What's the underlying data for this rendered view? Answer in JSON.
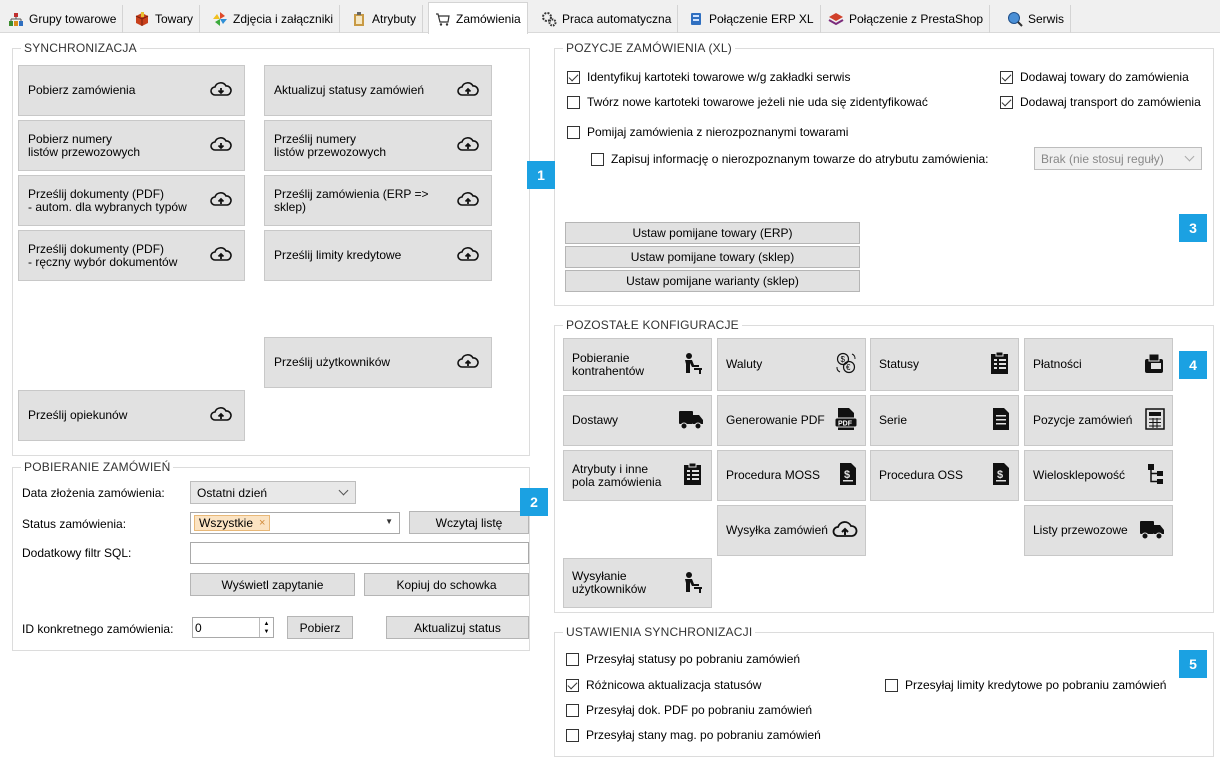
{
  "tabs": [
    {
      "label": "Grupy towarowe",
      "icon": "tree-icon"
    },
    {
      "label": "Towary",
      "icon": "box-icon"
    },
    {
      "label": "Zdjęcia i załączniki",
      "icon": "pinwheel-icon"
    },
    {
      "label": "Atrybuty",
      "icon": "clipboard-icon"
    },
    {
      "label": "Zamówienia",
      "icon": "cart-icon"
    },
    {
      "label": "Praca automatyczna",
      "icon": "gears-icon"
    },
    {
      "label": "Połączenie ERP XL",
      "icon": "database-icon"
    },
    {
      "label": "Połączenie z PrestaShop",
      "icon": "layers-icon"
    },
    {
      "label": "Serwis",
      "icon": "globe-search-icon"
    }
  ],
  "sync": {
    "title": "SYNCHRONIZACJA",
    "left": [
      "Pobierz zamówienia",
      "Pobierz numery\nlistów przewozowych",
      "Prześlij dokumenty (PDF)\n- autom. dla wybranych typów",
      "Prześlij dokumenty (PDF)\n- ręczny wybór dokumentów",
      "Prześlij opiekunów"
    ],
    "right": [
      "Aktualizuj statusy zamówień",
      "Prześlij numery\nlistów przewozowych",
      "Prześlij zamówienia (ERP =>\nsklep)",
      "Prześlij limity kredytowe",
      "Prześlij użytkowników"
    ]
  },
  "fetch": {
    "title": "POBIERANIE ZAMÓWIEŃ",
    "date_label": "Data złożenia zamówienia:",
    "date_value": "Ostatni dzień",
    "status_label": "Status zamówienia:",
    "status_token": "Wszystkie",
    "load_list": "Wczytaj listę",
    "sql_label": "Dodatkowy filtr SQL:",
    "sql_value": "",
    "show_query": "Wyświetl zapytanie",
    "copy_clipboard": "Kopiuj do schowka",
    "id_label": "ID konkretnego zamówienia:",
    "id_value": "0",
    "fetch_btn": "Pobierz",
    "update_status": "Aktualizuj status"
  },
  "positions": {
    "title": "POZYCJE ZAMÓWIENIA (XL)",
    "checks": [
      {
        "label": "Identyfikuj kartoteki towarowe w/g zakładki serwis",
        "checked": true
      },
      {
        "label": "Twórz nowe kartoteki towarowe jeżeli nie uda się zidentyfikować",
        "checked": false
      },
      {
        "label": "Pomijaj zamówienia z nierozpoznanymi towarami",
        "checked": false
      },
      {
        "label": "Zapisuj informację o nierozpoznanym towarze do atrybutu zamówienia:",
        "checked": false
      },
      {
        "label": "Dodawaj towary do zamówienia",
        "checked": true
      },
      {
        "label": "Dodawaj transport do zamówienia",
        "checked": true
      }
    ],
    "attr_select": "Brak (nie stosuj reguły)",
    "buttons": [
      "Ustaw pomijane towary (ERP)",
      "Ustaw pomijane towary (sklep)",
      "Ustaw pomijane warianty (sklep)"
    ]
  },
  "other": {
    "title": "POZOSTAŁE KONFIGURACJE",
    "buttons": [
      {
        "label": "Pobieranie\nkontrahentów",
        "icon": "person-desk-icon"
      },
      {
        "label": "Waluty",
        "icon": "currency-exchange-icon"
      },
      {
        "label": "Statusy",
        "icon": "clipboard-list-icon"
      },
      {
        "label": "Płatności",
        "icon": "register-icon"
      },
      {
        "label": "Dostawy",
        "icon": "truck-icon"
      },
      {
        "label": "Generowanie PDF",
        "icon": "pdf-icon"
      },
      {
        "label": "Serie",
        "icon": "document-icon"
      },
      {
        "label": "Pozycje zamówień",
        "icon": "calculator-icon"
      },
      {
        "label": "Atrybuty i inne\npola zamówienia",
        "icon": "clipboard-list-icon"
      },
      {
        "label": "Procedura MOSS",
        "icon": "dollar-doc-icon"
      },
      {
        "label": "Procedura OSS",
        "icon": "dollar-doc-icon"
      },
      {
        "label": "Wielosklepowość",
        "icon": "hierarchy-icon"
      },
      {
        "label": "Wysyłka zamówień",
        "icon": "cloud-upload-icon"
      },
      {
        "label": "Listy przewozowe",
        "icon": "truck-icon"
      },
      {
        "label": "Wysyłanie\nużytkowników",
        "icon": "person-desk-icon"
      }
    ]
  },
  "settings": {
    "title": "USTAWIENIA SYNCHRONIZACJI",
    "checks": [
      {
        "label": "Przesyłaj statusy po pobraniu zamówień",
        "checked": false
      },
      {
        "label": "Różnicowa aktualizacja statusów",
        "checked": true
      },
      {
        "label": "Przesyłaj dok. PDF po pobraniu zamówień",
        "checked": false
      },
      {
        "label": "Przesyłaj stany mag. po pobraniu zamówień",
        "checked": false
      },
      {
        "label": "Przesyłaj limity kredytowe po pobraniu zamówień",
        "checked": false
      }
    ]
  },
  "badges": [
    "1",
    "2",
    "3",
    "4",
    "5"
  ]
}
